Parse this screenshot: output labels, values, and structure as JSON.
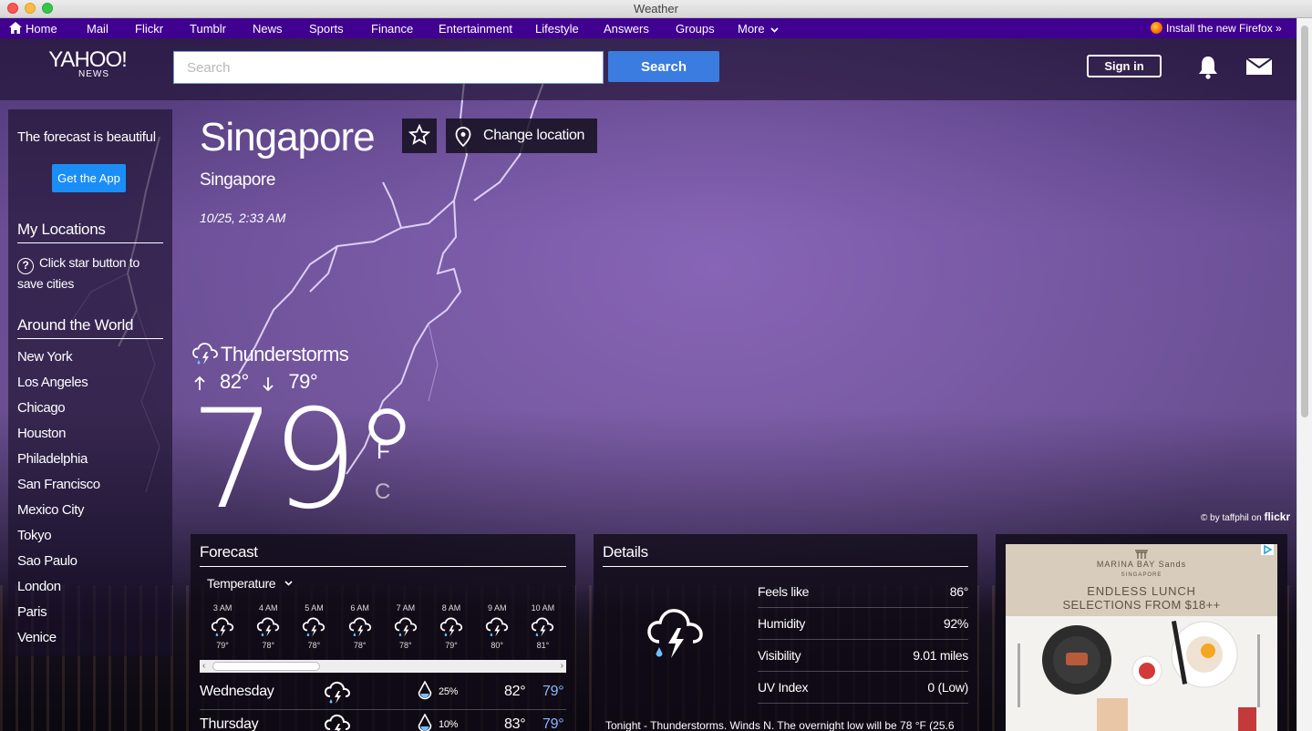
{
  "window": {
    "title": "Weather"
  },
  "topnav": {
    "items": [
      "Home",
      "Mail",
      "Flickr",
      "Tumblr",
      "News",
      "Sports",
      "Finance",
      "Entertainment",
      "Lifestyle",
      "Answers",
      "Groups",
      "More"
    ],
    "firefox_promo": "Install the new Firefox »"
  },
  "header": {
    "logo_main": "YAHOO!",
    "logo_sub": "NEWS",
    "search_placeholder": "Search",
    "search_button": "Search",
    "signin": "Sign in"
  },
  "sidebar": {
    "promo": "The forecast is beautiful",
    "app_button": "Get the App",
    "my_locations_title": "My Locations",
    "my_locations_hint": "Click star button to save cities",
    "world_title": "Around the World",
    "cities": [
      "New York",
      "Los Angeles",
      "Chicago",
      "Houston",
      "Philadelphia",
      "San Francisco",
      "Mexico City",
      "Tokyo",
      "Sao Paulo",
      "London",
      "Paris",
      "Venice"
    ]
  },
  "location": {
    "city": "Singapore",
    "country": "Singapore",
    "local_time": "10/25, 2:33 AM",
    "change_location": "Change location"
  },
  "current": {
    "condition": "Thunderstorms",
    "high": "82°",
    "low": "79°",
    "temp": "79°",
    "unit_f": "F",
    "unit_c": "C"
  },
  "photo_credit": {
    "prefix": "© by taffphil on",
    "site": "flickr"
  },
  "forecast": {
    "title": "Forecast",
    "selector": "Temperature",
    "hours": [
      {
        "time": "3 AM",
        "temp": "79°"
      },
      {
        "time": "4 AM",
        "temp": "78°"
      },
      {
        "time": "5 AM",
        "temp": "78°"
      },
      {
        "time": "6 AM",
        "temp": "78°"
      },
      {
        "time": "7 AM",
        "temp": "78°"
      },
      {
        "time": "8 AM",
        "temp": "79°"
      },
      {
        "time": "9 AM",
        "temp": "80°"
      },
      {
        "time": "10 AM",
        "temp": "81°"
      }
    ],
    "days": [
      {
        "name": "Wednesday",
        "precip": "25%",
        "high": "82°",
        "low": "79°"
      },
      {
        "name": "Thursday",
        "precip": "10%",
        "high": "83°",
        "low": "79°"
      }
    ]
  },
  "details": {
    "title": "Details",
    "rows": [
      {
        "label": "Feels like",
        "value": "86°"
      },
      {
        "label": "Humidity",
        "value": "92%"
      },
      {
        "label": "Visibility",
        "value": "9.01 miles"
      },
      {
        "label": "UV Index",
        "value": "0 (Low)"
      }
    ],
    "summary": "Tonight - Thunderstorms. Winds N. The overnight low will be 78 °F (25.6"
  },
  "ad": {
    "brand": "MARINA BAY Sands",
    "brand_sub": "SINGAPORE",
    "line1": "ENDLESS LUNCH",
    "line2": "SELECTIONS FROM $18++"
  },
  "colors": {
    "nav": "#400090",
    "search_button": "#3a7ce0",
    "app_button": "#1b8ef6",
    "low_temp": "#8bb8ff"
  }
}
